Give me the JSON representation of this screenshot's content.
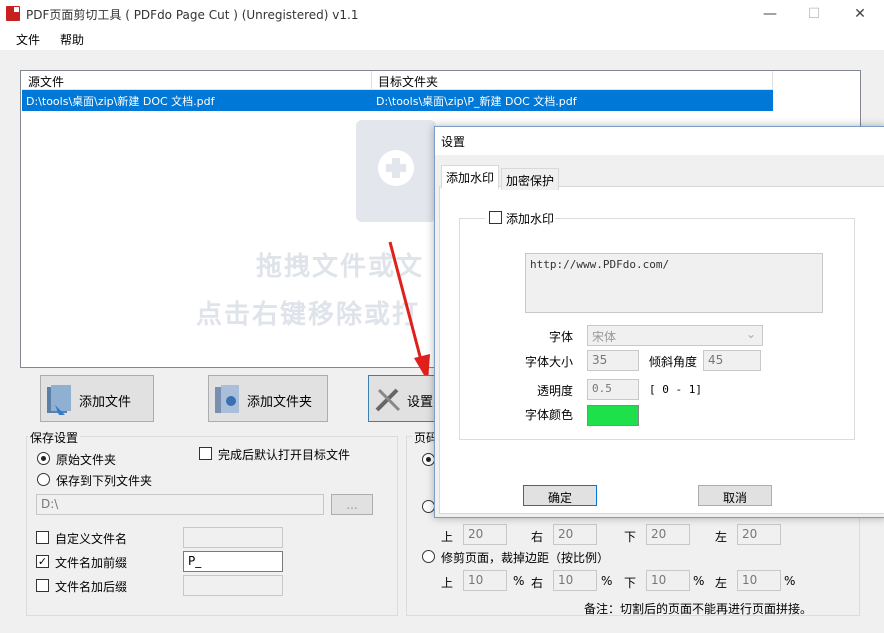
{
  "window": {
    "title": "PDF页面剪切工具 ( PDFdo Page Cut )  (Unregistered) v1.1",
    "min": "—",
    "max": "☐",
    "close": "✕"
  },
  "menu": {
    "file": "文件",
    "help": "帮助"
  },
  "list": {
    "headers": [
      "源文件",
      "目标文件夹"
    ],
    "rows": [
      {
        "source": "D:\\tools\\桌面\\zip\\新建 DOC 文档.pdf",
        "target": "D:\\tools\\桌面\\zip\\P_新建 DOC 文档.pdf"
      }
    ],
    "watermark1": "拖拽文件或文",
    "watermark2": "点击右键移除或打"
  },
  "buttons": {
    "add_file": "添加文件",
    "add_folder": "添加文件夹",
    "settings": "设置"
  },
  "save": {
    "title": "保存设置",
    "original_folder": "原始文件夹",
    "save_to": "保存到下列文件夹",
    "open_after": "完成后默认打开目标文件",
    "path": "D:\\",
    "browse": "...",
    "custom_name": "自定义文件名",
    "prefix": "文件名加前缀",
    "prefix_value": "P_",
    "suffix": "文件名加后缀"
  },
  "page": {
    "title": "页码",
    "top": "上",
    "right": "右",
    "bottom": "下",
    "left": "左",
    "margins": {
      "top": "20",
      "right": "20",
      "bottom": "20",
      "left": "20"
    },
    "trim_label": "修剪页面，裁掉边距（按比例）",
    "pct": {
      "top": "10",
      "right": "10",
      "bottom": "10",
      "left": "10"
    },
    "pct_unit": "%",
    "note": "备注：切割后的页面不能再进行页面拼接。"
  },
  "dialog": {
    "title": "设置",
    "tabs": [
      "添加水印",
      "加密保护"
    ],
    "add_watermark": "添加水印",
    "text": "http://www.PDFdo.com/",
    "font_label": "字体",
    "font_value": "宋体",
    "size_label": "字体大小",
    "size_value": "35",
    "angle_label": "倾斜角度",
    "angle_value": "45",
    "opacity_label": "透明度",
    "opacity_value": "0.5",
    "opacity_range": "[ 0 - 1]",
    "color_label": "字体颜色",
    "color": "#1ee04a",
    "ok": "确定",
    "cancel": "取消"
  }
}
